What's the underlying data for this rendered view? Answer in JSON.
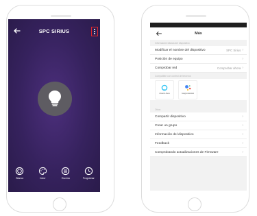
{
  "left_screen": {
    "title": "SPC SIRIUS",
    "bottom_bar": [
      {
        "label": "Blanco",
        "icon": "white-mode-icon"
      },
      {
        "label": "Color",
        "icon": "palette-icon"
      },
      {
        "label": "Escena",
        "icon": "scene-icon"
      },
      {
        "label": "Programar",
        "icon": "clock-icon"
      }
    ]
  },
  "right_screen": {
    "title": "Más",
    "basic_section_header": "Información básica del dispositivo",
    "rows_basic": [
      {
        "label": "Modificar el nombre del dispositivo",
        "value": "SPC Sirius"
      },
      {
        "label": "Posición de equipo",
        "value": ""
      },
      {
        "label": "Comprobar red",
        "value": "Comprobar ahora"
      }
    ],
    "services_header": "Compatible con control de terceros",
    "services": [
      {
        "label": "Amazon Alexa",
        "icon": "alexa-icon"
      },
      {
        "label": "Google Assistant",
        "icon": "google-assistant-icon"
      }
    ],
    "other_section_header": "Otros",
    "rows_other": [
      {
        "label": "Compartir dispositivo"
      },
      {
        "label": "Crear un grupo"
      },
      {
        "label": "Información del dispositivo"
      },
      {
        "label": "Feedback"
      },
      {
        "label": "Comprobando actualizaciones de Firmware"
      }
    ]
  }
}
